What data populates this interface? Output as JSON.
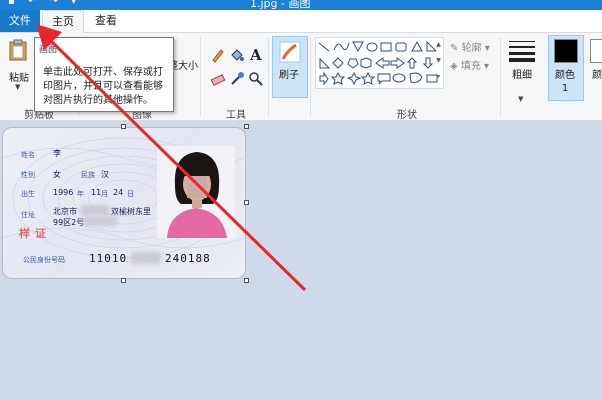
{
  "window": {
    "title": "1.jpg - 画图"
  },
  "tabs": {
    "file": "文件",
    "home": "主页",
    "view": "查看"
  },
  "ribbon": {
    "clipboard": {
      "paste": "粘贴",
      "group": "剪贴板"
    },
    "image": {
      "resize_fragment": "整大小",
      "group": "图像"
    },
    "tools": {
      "group": "工具"
    },
    "brushes": {
      "label": "刷子"
    },
    "shapes": {
      "outline": "轮廓",
      "fill": "填充",
      "group": "形状"
    },
    "size": {
      "label": "粗细"
    },
    "color1": {
      "label": "颜色 1",
      "color": "#000000"
    },
    "color2": {
      "label": "颜",
      "color": "#ffffff"
    }
  },
  "tooltip": {
    "title": "画图",
    "body": "单击此处可打开、保存或打印图片，并且可以查看能够对图片执行的其他操作。"
  },
  "id_card": {
    "name_label": "姓名",
    "name_value": "李",
    "gender_label": "性别",
    "gender_value": "女",
    "ethnicity_label": "民族",
    "ethnicity_value": "汉",
    "birth_label": "出生",
    "birth_year": "1996",
    "birth_year_unit": "年",
    "birth_month": "11",
    "birth_month_unit": "月",
    "birth_day": "24",
    "birth_day_unit": "日",
    "address_label": "住址",
    "address_line1": "北京市",
    "address_line1_end": "双榆树东里",
    "address_line2": "99区2号",
    "stamp": "样证",
    "id_label": "公民身份号码",
    "id_number": "11010",
    "id_number_end": "240188"
  },
  "colors": {
    "accent": "#1979ca",
    "arrow": "#e8262f",
    "canvas_bg": "#cfd9e8"
  }
}
